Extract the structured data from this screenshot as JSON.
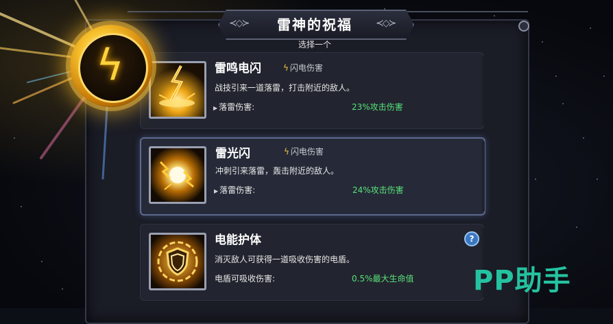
{
  "panel": {
    "title": "雷神的祝福",
    "subtitle": "选择一个"
  },
  "cards": [
    {
      "name": "雷鸣电闪",
      "tag": "闪电伤害",
      "desc": "战技引来一道落雷，打击附近的敌人。",
      "stat_label": "落雷伤害:",
      "stat_value": "23%攻击伤害",
      "icon": "lightning-strike-icon",
      "selected": false
    },
    {
      "name": "雷光闪",
      "tag": "闪电伤害",
      "desc": "冲刺引来落雷，轰击附近的敌人。",
      "stat_label": "落雷伤害:",
      "stat_value": "24%攻击伤害",
      "icon": "lightning-orb-icon",
      "selected": true
    },
    {
      "name": "电能护体",
      "tag": "",
      "desc": "消灭敌人可获得一道吸收伤害的电盾。",
      "stat_label": "电盾可吸收伤害:",
      "stat_value": "0.5%最大生命值",
      "icon": "lightning-shield-icon",
      "help": "?",
      "selected": false
    }
  ],
  "watermark": "PP助手",
  "colors": {
    "accent_gold": "#f8c12d",
    "value_green": "#58e27a",
    "help_blue": "#3b78c2",
    "watermark_teal": "#25c2a0"
  }
}
